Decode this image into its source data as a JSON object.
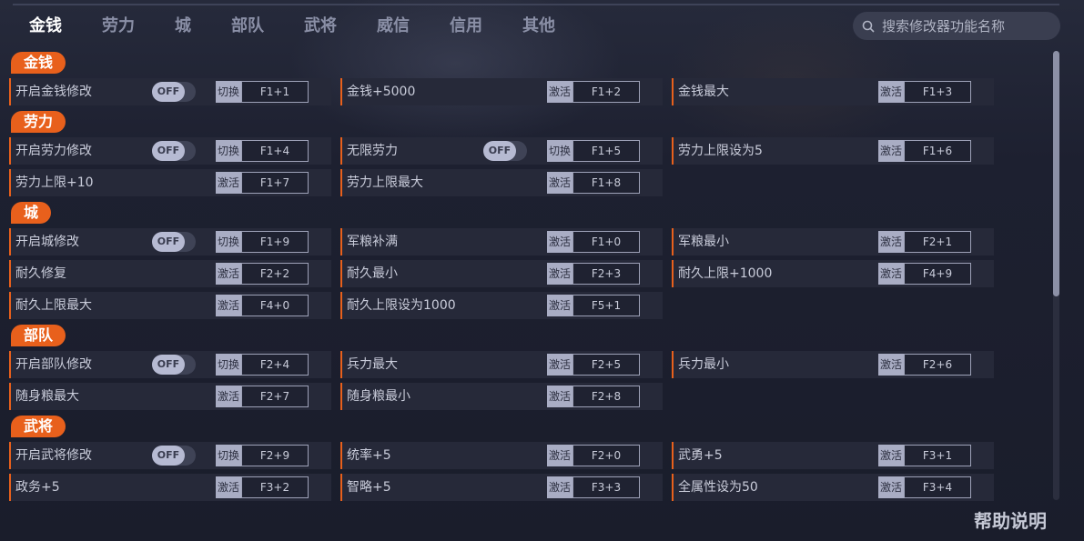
{
  "tabs": [
    "金钱",
    "劳力",
    "城",
    "部队",
    "武将",
    "威信",
    "信用",
    "其他"
  ],
  "active_tab": 0,
  "search": {
    "placeholder": "搜索修改器功能名称"
  },
  "sections": [
    {
      "label": "金钱",
      "items": [
        {
          "name": "开启金钱修改",
          "toggle": "OFF",
          "action": "切换",
          "hotkey": "F1+1"
        },
        {
          "name": "金钱+5000",
          "action": "激活",
          "hotkey": "F1+2"
        },
        {
          "name": "金钱最大",
          "action": "激活",
          "hotkey": "F1+3"
        }
      ]
    },
    {
      "label": "劳力",
      "items": [
        {
          "name": "开启劳力修改",
          "toggle": "OFF",
          "action": "切换",
          "hotkey": "F1+4"
        },
        {
          "name": "无限劳力",
          "toggle": "OFF",
          "action": "切换",
          "hotkey": "F1+5"
        },
        {
          "name": "劳力上限设为5",
          "action": "激活",
          "hotkey": "F1+6"
        },
        {
          "name": "劳力上限+10",
          "action": "激活",
          "hotkey": "F1+7"
        },
        {
          "name": "劳力上限最大",
          "action": "激活",
          "hotkey": "F1+8"
        }
      ]
    },
    {
      "label": "城",
      "items": [
        {
          "name": "开启城修改",
          "toggle": "OFF",
          "action": "切换",
          "hotkey": "F1+9"
        },
        {
          "name": "军粮补满",
          "action": "激活",
          "hotkey": "F1+0"
        },
        {
          "name": "军粮最小",
          "action": "激活",
          "hotkey": "F2+1"
        },
        {
          "name": "耐久修复",
          "action": "激活",
          "hotkey": "F2+2"
        },
        {
          "name": "耐久最小",
          "action": "激活",
          "hotkey": "F2+3"
        },
        {
          "name": "耐久上限+1000",
          "action": "激活",
          "hotkey": "F4+9"
        },
        {
          "name": "耐久上限最大",
          "action": "激活",
          "hotkey": "F4+0"
        },
        {
          "name": "耐久上限设为1000",
          "action": "激活",
          "hotkey": "F5+1"
        }
      ]
    },
    {
      "label": "部队",
      "items": [
        {
          "name": "开启部队修改",
          "toggle": "OFF",
          "action": "切换",
          "hotkey": "F2+4"
        },
        {
          "name": "兵力最大",
          "action": "激活",
          "hotkey": "F2+5"
        },
        {
          "name": "兵力最小",
          "action": "激活",
          "hotkey": "F2+6"
        },
        {
          "name": "随身粮最大",
          "action": "激活",
          "hotkey": "F2+7"
        },
        {
          "name": "随身粮最小",
          "action": "激活",
          "hotkey": "F2+8"
        }
      ]
    },
    {
      "label": "武将",
      "items": [
        {
          "name": "开启武将修改",
          "toggle": "OFF",
          "action": "切换",
          "hotkey": "F2+9"
        },
        {
          "name": "统率+5",
          "action": "激活",
          "hotkey": "F2+0"
        },
        {
          "name": "武勇+5",
          "action": "激活",
          "hotkey": "F3+1"
        },
        {
          "name": "政务+5",
          "action": "激活",
          "hotkey": "F3+2"
        },
        {
          "name": "智略+5",
          "action": "激活",
          "hotkey": "F3+3"
        },
        {
          "name": "全属性设为50",
          "action": "激活",
          "hotkey": "F3+4"
        }
      ]
    }
  ],
  "help_label": "帮助说明",
  "colors": {
    "accent": "#e8601c",
    "background": "#1c1f2e",
    "row": "#262939"
  }
}
